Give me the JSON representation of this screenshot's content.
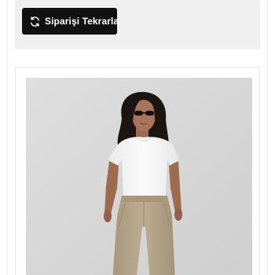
{
  "reorder": {
    "label": "Siparişi Tekrarla",
    "icon": "refresh-icon"
  },
  "product": {
    "image_icon": "product-photo"
  },
  "colors": {
    "button_bg": "#111111",
    "button_text": "#ffffff",
    "card_bg": "#efefef",
    "page_bg": "#ffffff",
    "photo_bg": "#dadada"
  }
}
